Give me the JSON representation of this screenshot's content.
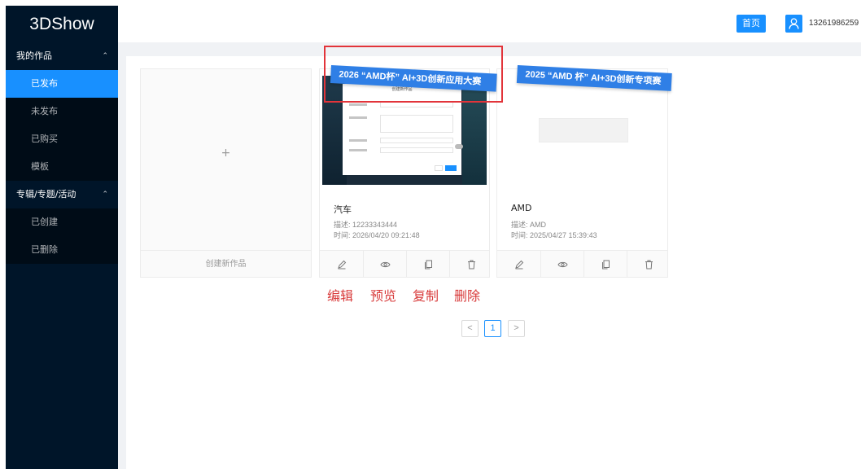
{
  "app": {
    "logo": "3DShow"
  },
  "sidebar": {
    "groups": [
      {
        "label": "我的作品",
        "items": [
          {
            "label": "已发布",
            "active": true
          },
          {
            "label": "未发布"
          },
          {
            "label": "已购买"
          },
          {
            "label": "模板"
          }
        ]
      },
      {
        "label": "专辑/专题/活动",
        "items": [
          {
            "label": "已创建"
          },
          {
            "label": "已删除"
          }
        ]
      }
    ]
  },
  "header": {
    "home_label": "首页",
    "user_phone": "13261986259"
  },
  "cards": {
    "new_card": {
      "plus": "+",
      "label": "创建新作品"
    },
    "items": [
      {
        "title": "汽车",
        "desc": "描述: 12233343444",
        "time": "时间: 2026/04/20 09:21:48",
        "ribbon": "2026 “AMD杯” AI+3D创新应用大赛",
        "thumb_dialog_title": "创建新作品"
      },
      {
        "title": "AMD",
        "desc": "描述: AMD",
        "time": "时间: 2025/04/27 15:39:43",
        "ribbon": "2025 “AMD 杯” AI+3D创新专项赛"
      }
    ]
  },
  "annotations": {
    "edit": "编辑",
    "preview": "预览",
    "copy": "复制",
    "delete": "删除"
  },
  "pagination": {
    "prev": "<",
    "current": "1",
    "next": ">"
  },
  "colors": {
    "sidebar_bg": "#001529",
    "accent": "#1890ff",
    "annotation": "#d83b3b",
    "ribbon": "#2f7fe6"
  }
}
